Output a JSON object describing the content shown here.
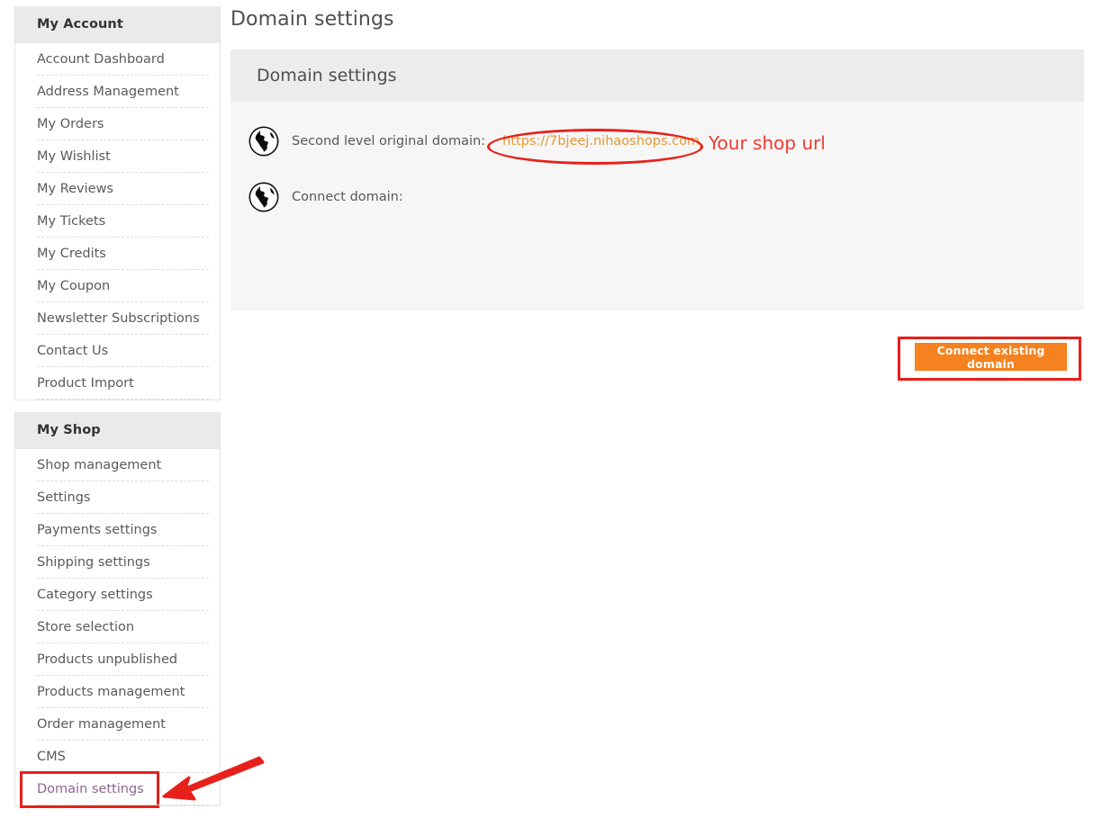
{
  "page": {
    "title": "Domain settings"
  },
  "sidebar": {
    "blocks": [
      {
        "header": "My Account",
        "items": [
          {
            "label": "Account Dashboard"
          },
          {
            "label": "Address Management"
          },
          {
            "label": "My Orders"
          },
          {
            "label": "My Wishlist"
          },
          {
            "label": "My Reviews"
          },
          {
            "label": "My Tickets"
          },
          {
            "label": "My Credits"
          },
          {
            "label": "My Coupon"
          },
          {
            "label": "Newsletter Subscriptions"
          },
          {
            "label": "Contact Us"
          },
          {
            "label": "Product Import"
          }
        ]
      },
      {
        "header": "My Shop",
        "items": [
          {
            "label": "Shop management"
          },
          {
            "label": "Settings"
          },
          {
            "label": "Payments settings"
          },
          {
            "label": "Shipping settings"
          },
          {
            "label": "Category settings"
          },
          {
            "label": "Store selection"
          },
          {
            "label": "Products unpublished"
          },
          {
            "label": "Products management"
          },
          {
            "label": "Order management"
          },
          {
            "label": "CMS"
          },
          {
            "label": "Domain settings"
          }
        ]
      }
    ]
  },
  "card": {
    "header": "Domain settings",
    "rows": [
      {
        "icon": "globe-icon",
        "label": "Second level original domain:",
        "value": "https://7bjeej.nihaoshops.com"
      },
      {
        "icon": "globe-icon",
        "label": "Connect domain:",
        "value": ""
      }
    ],
    "connect_button_label": "Connect existing domain"
  },
  "annotations": {
    "shop_url_note": "Your shop url"
  },
  "colors": {
    "accent_orange": "#f5821f",
    "link_orange": "#e5962f",
    "annotation_red": "#e8201a",
    "note_red": "#f23a30",
    "visited_purple": "#8d6590",
    "card_header_gray": "#ececec",
    "card_body_gray": "#f6f6f6",
    "sidebar_header_gray": "#eaeaea"
  }
}
